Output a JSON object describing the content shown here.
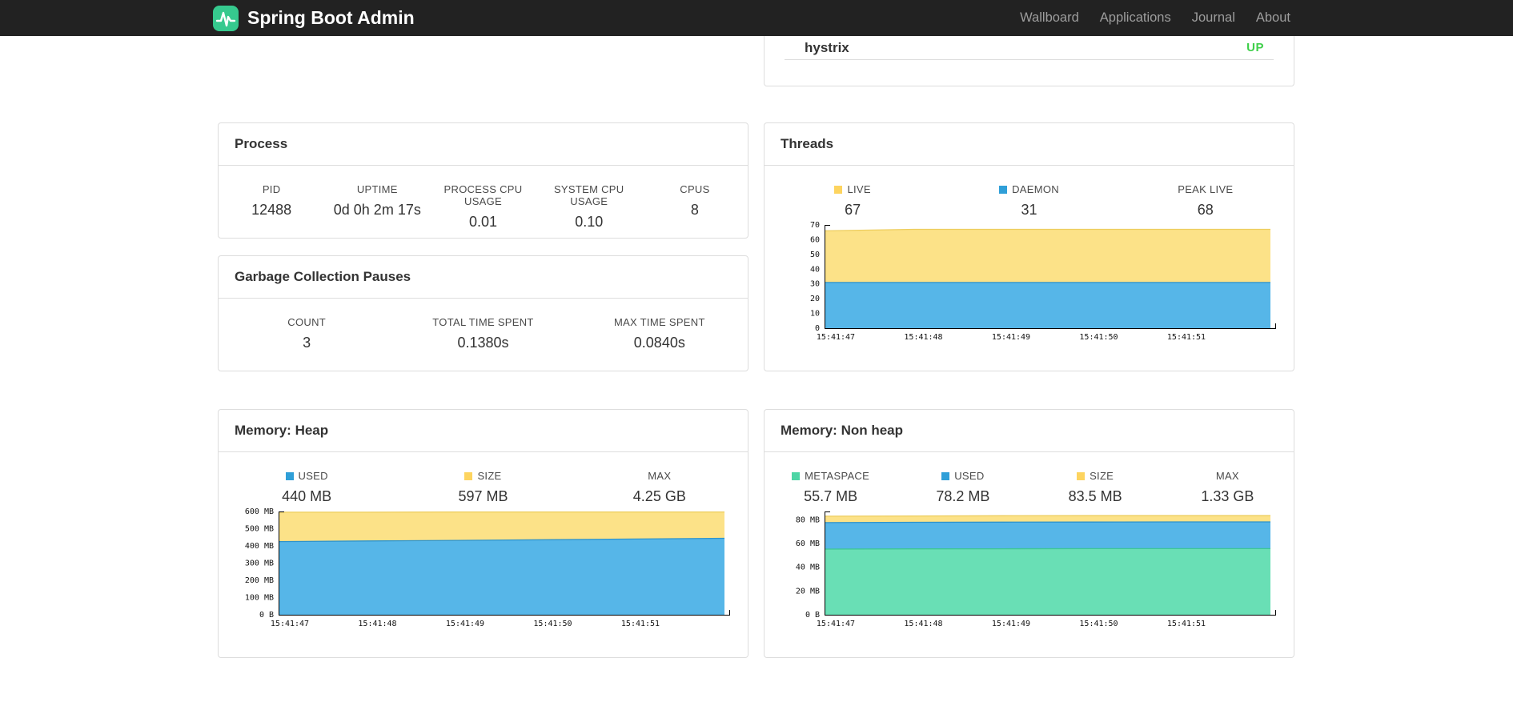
{
  "navbar": {
    "brand": "Spring Boot Admin",
    "links": [
      {
        "label": "Wallboard"
      },
      {
        "label": "Applications"
      },
      {
        "label": "Journal"
      },
      {
        "label": "About"
      }
    ]
  },
  "colors": {
    "brand_green": "#36c98e",
    "status_up": "#3fcf4a",
    "chart_yellow": "#fce288",
    "chart_blue": "#56b6e8",
    "chart_green": "#69dfb5",
    "panel_border": "#dddddd",
    "navbar_bg": "#222222"
  },
  "applications_panel": {
    "app_name": "hystrix",
    "status": "UP",
    "status_color": "#3fcf4a"
  },
  "process": {
    "title": "Process",
    "metrics": [
      {
        "label": "PID",
        "value": "12488",
        "swatch": null
      },
      {
        "label": "UPTIME",
        "value": "0d 0h 2m 17s",
        "swatch": null
      },
      {
        "label": "PROCESS CPU USAGE",
        "value": "0.01",
        "swatch": null
      },
      {
        "label": "SYSTEM CPU USAGE",
        "value": "0.10",
        "swatch": null
      },
      {
        "label": "CPUS",
        "value": "8",
        "swatch": null
      }
    ]
  },
  "gc": {
    "title": "Garbage Collection Pauses",
    "metrics": [
      {
        "label": "COUNT",
        "value": "3",
        "swatch": null
      },
      {
        "label": "TOTAL TIME SPENT",
        "value": "0.1380s",
        "swatch": null
      },
      {
        "label": "MAX TIME SPENT",
        "value": "0.0840s",
        "swatch": null
      }
    ]
  },
  "threads": {
    "title": "Threads",
    "legend": [
      {
        "label": "LIVE",
        "value": "67",
        "swatch": "#fdd45f"
      },
      {
        "label": "DAEMON",
        "value": "31",
        "swatch": "#2f9fd8"
      },
      {
        "label": "PEAK LIVE",
        "value": "68",
        "swatch": null
      }
    ]
  },
  "memory_heap": {
    "title": "Memory: Heap",
    "legend": [
      {
        "label": "USED",
        "value": "440 MB",
        "swatch": "#2f9fd8"
      },
      {
        "label": "SIZE",
        "value": "597 MB",
        "swatch": "#fdd45f"
      },
      {
        "label": "MAX",
        "value": "4.25 GB",
        "swatch": null
      }
    ]
  },
  "memory_nonheap": {
    "title": "Memory: Non heap",
    "legend": [
      {
        "label": "METASPACE",
        "value": "55.7 MB",
        "swatch": "#4dd5a5"
      },
      {
        "label": "USED",
        "value": "78.2 MB",
        "swatch": "#2f9fd8"
      },
      {
        "label": "SIZE",
        "value": "83.5 MB",
        "swatch": "#fdd45f"
      },
      {
        "label": "MAX",
        "value": "1.33 GB",
        "swatch": null
      }
    ]
  },
  "chart_data": [
    {
      "id": "threads",
      "type": "area",
      "title": "Threads",
      "x_labels": [
        "15:41:47",
        "15:41:48",
        "15:41:49",
        "15:41:50",
        "15:41:51"
      ],
      "y_max": 70,
      "y_ticks": [
        {
          "v": 0,
          "label": "0"
        },
        {
          "v": 10,
          "label": "10"
        },
        {
          "v": 20,
          "label": "20"
        },
        {
          "v": 30,
          "label": "30"
        },
        {
          "v": 40,
          "label": "40"
        },
        {
          "v": 50,
          "label": "50"
        },
        {
          "v": 60,
          "label": "60"
        },
        {
          "v": 70,
          "label": "70"
        }
      ],
      "series": [
        {
          "name": "live",
          "fill": "#fce288",
          "stroke": "#edcd5d",
          "values": [
            66,
            67,
            67,
            67,
            67,
            67
          ]
        },
        {
          "name": "daemon",
          "fill": "#56b6e8",
          "stroke": "#2e93cb",
          "values": [
            31,
            31,
            31,
            31,
            31,
            31
          ]
        }
      ]
    },
    {
      "id": "memory-heap",
      "type": "area",
      "title": "Memory: Heap",
      "x_labels": [
        "15:41:47",
        "15:41:48",
        "15:41:49",
        "15:41:50",
        "15:41:51"
      ],
      "y_max": 600,
      "y_ticks": [
        {
          "v": 0,
          "label": "0 B"
        },
        {
          "v": 100,
          "label": "100 MB"
        },
        {
          "v": 200,
          "label": "200 MB"
        },
        {
          "v": 300,
          "label": "300 MB"
        },
        {
          "v": 400,
          "label": "400 MB"
        },
        {
          "v": 500,
          "label": "500 MB"
        },
        {
          "v": 600,
          "label": "600 MB"
        }
      ],
      "series": [
        {
          "name": "size",
          "fill": "#fce288",
          "stroke": "#edcd5d",
          "values": [
            596,
            596,
            597,
            597,
            597,
            597
          ]
        },
        {
          "name": "used",
          "fill": "#56b6e8",
          "stroke": "#2e93cb",
          "values": [
            425,
            429,
            432,
            436,
            440,
            444
          ]
        }
      ]
    },
    {
      "id": "memory-nonheap",
      "type": "area",
      "title": "Memory: Non heap",
      "x_labels": [
        "15:41:47",
        "15:41:48",
        "15:41:49",
        "15:41:50",
        "15:41:51"
      ],
      "y_max": 87,
      "y_ticks": [
        {
          "v": 0,
          "label": "0 B"
        },
        {
          "v": 20,
          "label": "20 MB"
        },
        {
          "v": 40,
          "label": "40 MB"
        },
        {
          "v": 60,
          "label": "60 MB"
        },
        {
          "v": 80,
          "label": "80 MB"
        }
      ],
      "series": [
        {
          "name": "size",
          "fill": "#fce288",
          "stroke": "#edcd5d",
          "values": [
            83,
            83.2,
            83.4,
            83.5,
            83.5,
            83.5
          ]
        },
        {
          "name": "used",
          "fill": "#56b6e8",
          "stroke": "#2e93cb",
          "values": [
            77.6,
            77.9,
            78,
            78.1,
            78.2,
            78.2
          ]
        },
        {
          "name": "metaspace",
          "fill": "#69dfb5",
          "stroke": "#3dc795",
          "values": [
            55.3,
            55.5,
            55.6,
            55.7,
            55.7,
            55.7
          ]
        }
      ]
    }
  ]
}
